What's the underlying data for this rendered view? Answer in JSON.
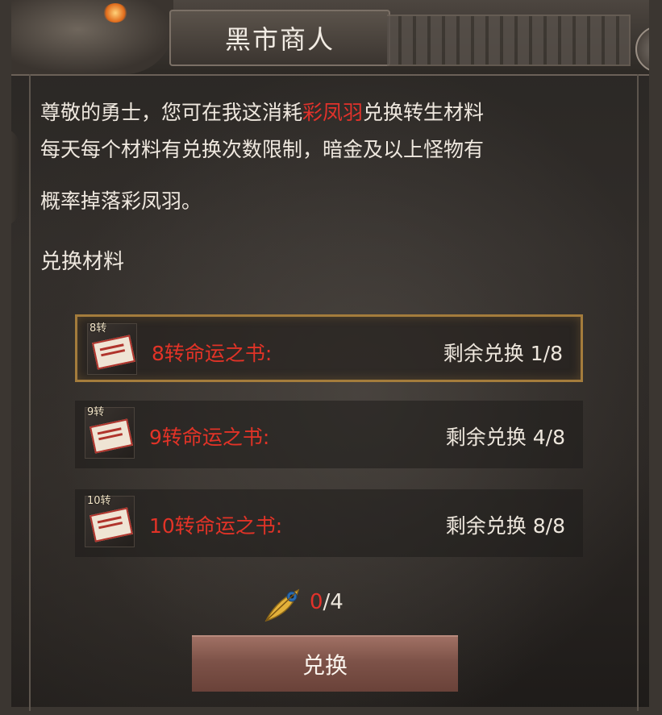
{
  "window": {
    "title": "黑市商人",
    "close_icon": "close-icon"
  },
  "description": {
    "line1_prefix": "尊敬的勇士，您可在我这消耗",
    "line1_highlight": "彩凤羽",
    "line1_suffix": "兑换转生材料",
    "line2": "每天每个材料有兑换次数限制，暗金及以上怪物有",
    "line3": "概率掉落彩凤羽。"
  },
  "section_title": "兑换材料",
  "items": [
    {
      "tag": "8转",
      "name": "8转命运之书:",
      "remaining_label": "剩余兑换",
      "remaining_value": "1/8",
      "selected": true
    },
    {
      "tag": "9转",
      "name": "9转命运之书:",
      "remaining_label": "剩余兑换",
      "remaining_value": "4/8",
      "selected": false
    },
    {
      "tag": "10转",
      "name": "10转命运之书:",
      "remaining_label": "剩余兑换",
      "remaining_value": "8/8",
      "selected": false
    }
  ],
  "cost": {
    "icon": "feather-icon",
    "owned": "0",
    "separator_required": "/4"
  },
  "exchange_button": "兑换",
  "colors": {
    "highlight_red": "#e2322b",
    "selected_border": "#a47c3c",
    "button": "#7d5248"
  }
}
